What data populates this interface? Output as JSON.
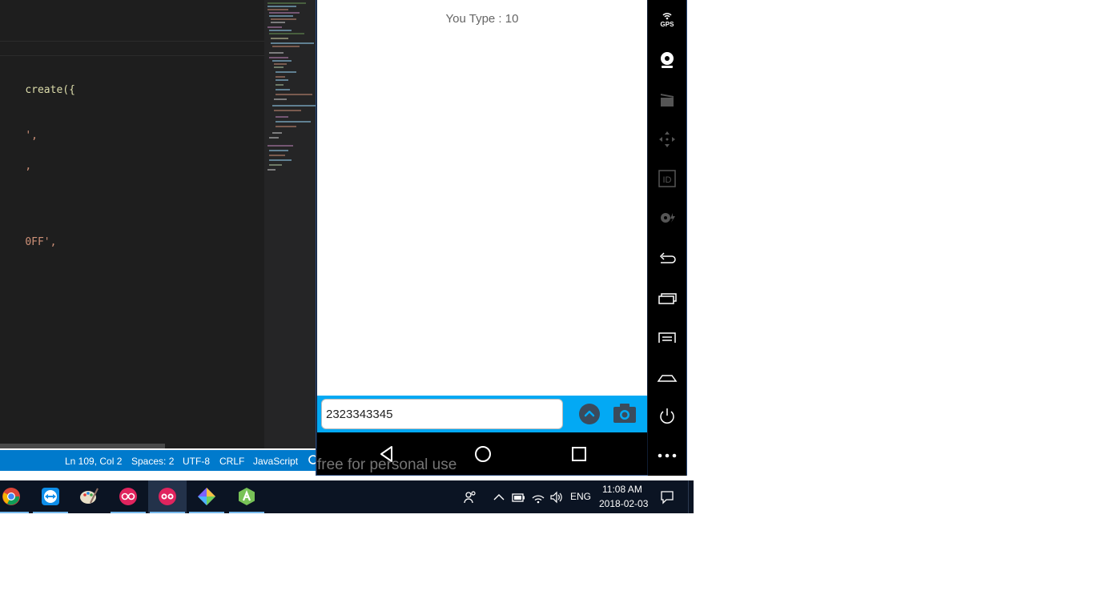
{
  "editor": {
    "code_lines": [
      {
        "text": "create({",
        "cls": "tok-fn"
      },
      {
        "text": "',",
        "cls": "tok-str"
      },
      {
        "text": ",",
        "cls": "tok-str"
      },
      {
        "text": "0FF',",
        "cls": "tok-str"
      }
    ]
  },
  "status_bar": {
    "position": "Ln 109, Col 2",
    "spaces": "Spaces: 2",
    "encoding": "UTF-8",
    "eol": "CRLF",
    "language": "JavaScript"
  },
  "app": {
    "type_label": "You Type : 10",
    "input_value": "2323343345",
    "accent_color": "#03a9f4"
  },
  "emulator_toolbar": {
    "gps_label": "GPS",
    "id_label": "ID",
    "icons": [
      "gps-icon",
      "webcam-icon",
      "screen-record-icon",
      "move-icon",
      "device-id-icon",
      "media-icon",
      "back-icon",
      "recent-apps-icon",
      "menu-icon",
      "home-icon",
      "power-icon",
      "more-icon"
    ]
  },
  "watermark": "free for personal use",
  "taskbar": {
    "apps": [
      "chrome",
      "teamviewer",
      "paint",
      "genymotion",
      "genymotion-active",
      "sourcetree",
      "android-studio"
    ],
    "language": "ENG",
    "time": "11:08 AM",
    "date": "2018-02-03"
  }
}
